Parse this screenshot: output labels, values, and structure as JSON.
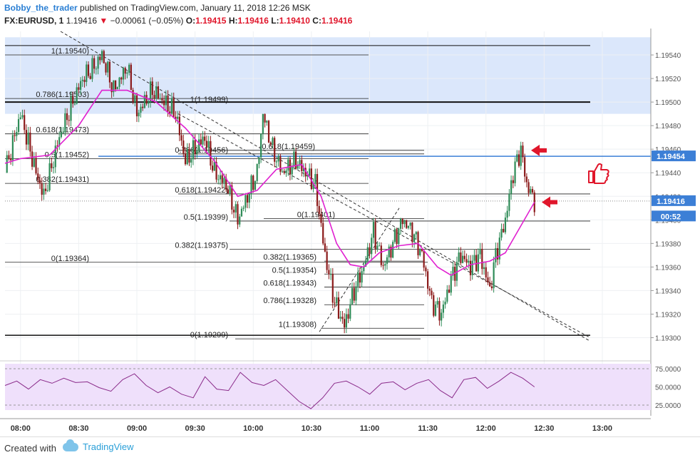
{
  "header": {
    "author": "Bobby_the_trader",
    "published": "published on TradingView.com, January 11, 2018 12:26 MSK",
    "symbol": "FX:EURUSD, 1",
    "last": "1.19416",
    "change_arrow": "▼",
    "change": "−0.00061 (−0.05%)",
    "o_label": "O:",
    "o_val": "1.19415",
    "h_label": "H:",
    "h_val": "1.19416",
    "l_label": "L:",
    "l_val": "1.19410",
    "c_label": "C:",
    "c_val": "1.19416"
  },
  "footer": {
    "created": "Created with",
    "brand": "TradingView"
  },
  "colors": {
    "up": "#2e8b57",
    "down": "#8b1a1a",
    "ma": "#e020d0",
    "rsi": "#8a2b8a",
    "zone": "#dbe7fb",
    "rsi_bg": "#efe0fb",
    "axis_text": "#555555",
    "price_tag": "#3c7fd6",
    "arrow": "#e0162b"
  },
  "chart_data": [
    {
      "type": "candlestick",
      "ylim": [
        1.1929,
        1.1956
      ],
      "y_ticks": [
        "1.19540",
        "1.19520",
        "1.19500",
        "1.19480",
        "1.19460",
        "1.19440",
        "1.19420",
        "1.19400",
        "1.19380",
        "1.19360",
        "1.19340",
        "1.19320",
        "1.19300"
      ],
      "x_ticks": [
        "08:00",
        "08:30",
        "09:00",
        "09:30",
        "10:00",
        "10:30",
        "11:00",
        "11:30",
        "12:00",
        "12:30",
        "13:00"
      ],
      "x_range_minutes": [
        "07:52",
        "13:25"
      ],
      "price_labels": [
        {
          "text": "1.19454",
          "color": "#3c7fd6",
          "value": 1.19454
        },
        {
          "text": "1.19416",
          "color": "#3c7fd6",
          "value": 1.19416
        },
        {
          "text": "00:52",
          "color": "#3c7fd6",
          "value": 1.19403
        }
      ],
      "path_points": [
        [
          "07:52",
          1.1944
        ],
        [
          "08:00",
          1.1949
        ],
        [
          "08:08",
          1.1944
        ],
        [
          "08:12",
          1.1942
        ],
        [
          "08:20",
          1.1947
        ],
        [
          "08:27",
          1.195
        ],
        [
          "08:32",
          1.1952
        ],
        [
          "08:38",
          1.1953
        ],
        [
          "08:42",
          1.1954
        ],
        [
          "08:48",
          1.1951
        ],
        [
          "08:55",
          1.1953
        ],
        [
          "09:00",
          1.1949
        ],
        [
          "09:08",
          1.1951
        ],
        [
          "09:14",
          1.195
        ],
        [
          "09:20",
          1.1949
        ],
        [
          "09:25",
          1.1945
        ],
        [
          "09:35",
          1.1947
        ],
        [
          "09:40",
          1.1944
        ],
        [
          "09:46",
          1.1943
        ],
        [
          "09:52",
          1.194
        ],
        [
          "09:57",
          1.1942
        ],
        [
          "10:02",
          1.1944
        ],
        [
          "10:05",
          1.1949
        ],
        [
          "10:10",
          1.1946
        ],
        [
          "10:15",
          1.1944
        ],
        [
          "10:22",
          1.1945
        ],
        [
          "10:27",
          1.1944
        ],
        [
          "10:32",
          1.1943
        ],
        [
          "10:37",
          1.1937
        ],
        [
          "10:42",
          1.1933
        ],
        [
          "10:47",
          1.1931
        ],
        [
          "10:52",
          1.1934
        ],
        [
          "10:57",
          1.1936
        ],
        [
          "11:02",
          1.1939
        ],
        [
          "11:07",
          1.1936
        ],
        [
          "11:12",
          1.1938
        ],
        [
          "11:17",
          1.194
        ],
        [
          "11:22",
          1.1939
        ],
        [
          "11:27",
          1.1937
        ],
        [
          "11:32",
          1.1933
        ],
        [
          "11:37",
          1.1932
        ],
        [
          "11:42",
          1.1935
        ],
        [
          "11:47",
          1.1937
        ],
        [
          "11:52",
          1.1936
        ],
        [
          "11:57",
          1.1937
        ],
        [
          "12:02",
          1.1934
        ],
        [
          "12:05",
          1.1937
        ],
        [
          "12:10",
          1.194
        ],
        [
          "12:14",
          1.1944
        ],
        [
          "12:18",
          1.1946
        ],
        [
          "12:21",
          1.1943
        ],
        [
          "12:25",
          1.19416
        ]
      ],
      "ma_points": [
        [
          "07:52",
          1.19448
        ],
        [
          "08:00",
          1.19452
        ],
        [
          "08:15",
          1.19455
        ],
        [
          "08:30",
          1.1948
        ],
        [
          "08:42",
          1.1951
        ],
        [
          "08:55",
          1.1951
        ],
        [
          "09:10",
          1.195
        ],
        [
          "09:25",
          1.19478
        ],
        [
          "09:40",
          1.1945
        ],
        [
          "09:52",
          1.1942
        ],
        [
          "10:02",
          1.19425
        ],
        [
          "10:12",
          1.19443
        ],
        [
          "10:25",
          1.19447
        ],
        [
          "10:35",
          1.1942
        ],
        [
          "10:43",
          1.1938
        ],
        [
          "10:50",
          1.19362
        ],
        [
          "10:57",
          1.1936
        ],
        [
          "11:05",
          1.19372
        ],
        [
          "11:15",
          1.19378
        ],
        [
          "11:25",
          1.1938
        ],
        [
          "11:35",
          1.1936
        ],
        [
          "11:42",
          1.19353
        ],
        [
          "11:52",
          1.19362
        ],
        [
          "12:02",
          1.19365
        ],
        [
          "12:10",
          1.19372
        ],
        [
          "12:18",
          1.19395
        ],
        [
          "12:25",
          1.19415
        ]
      ],
      "rsi": {
        "levels": [
          "75.0000",
          "50.0000",
          "25.0000"
        ],
        "values": [
          52,
          58,
          47,
          60,
          55,
          62,
          56,
          57,
          49,
          44,
          60,
          68,
          52,
          42,
          50,
          40,
          35,
          64,
          47,
          45,
          70,
          56,
          52,
          60,
          45,
          30,
          20,
          35,
          55,
          58,
          50,
          40,
          55,
          57,
          46,
          55,
          60,
          45,
          35,
          60,
          63,
          48,
          58,
          70,
          62,
          50
        ]
      },
      "fib_labels": [
        {
          "text": "1(1.19540)"
        },
        {
          "text": "0.786(1.19503)"
        },
        {
          "text": "1(1.19499)"
        },
        {
          "text": "0.618(1.19473)"
        },
        {
          "text": "0.5(1.19452)"
        },
        {
          "text": "0.786(1.19456)"
        },
        {
          "text": "-0.618(1.19459)"
        },
        {
          "text": "0.382(1.19431)"
        },
        {
          "text": "0.618(1.19422)"
        },
        {
          "text": "0(1.19401)"
        },
        {
          "text": "0.5(1.19399)"
        },
        {
          "text": "0.382(1.19375)"
        },
        {
          "text": "0(1.19364)"
        },
        {
          "text": "0.382(1.19365)"
        },
        {
          "text": "0.5(1.19354)"
        },
        {
          "text": "0.618(1.19343)"
        },
        {
          "text": "0.786(1.19328)"
        },
        {
          "text": "1(1.19308)"
        },
        {
          "text": "0(1.19299)"
        }
      ],
      "icons": [
        "left-arrow-icon",
        "left-arrow-icon",
        "thumbs-up-icon"
      ]
    }
  ]
}
